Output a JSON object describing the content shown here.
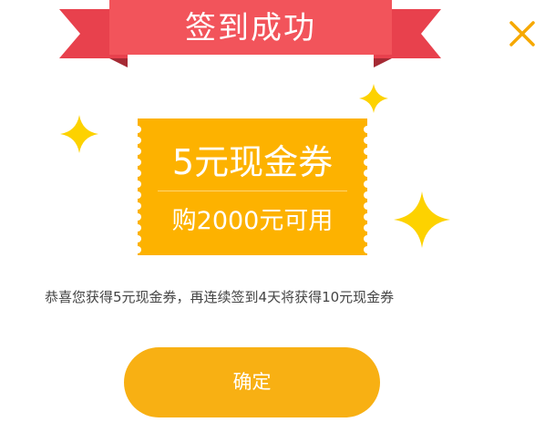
{
  "header": {
    "title": "签到成功"
  },
  "close": {
    "icon": "close-icon"
  },
  "coupon": {
    "amount_label": "5元现金券",
    "condition_label": "购2000元可用"
  },
  "message": "恭喜您获得5元现金券，再连续签到4天将获得10元现金券",
  "actions": {
    "confirm_label": "确定"
  },
  "colors": {
    "ribbon_main": "#f2545b",
    "ribbon_dark": "#d73b44",
    "coupon": "#fdb200",
    "sparkle": "#fdd200",
    "close": "#f6a800",
    "button": "#f8b013"
  }
}
